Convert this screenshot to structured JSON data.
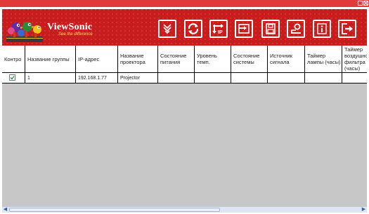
{
  "brand": {
    "name": "ViewSonic",
    "tagline": "See the difference"
  },
  "toolbar": {
    "buttons": [
      {
        "name": "filter-button",
        "icon": "chevron-down-icon"
      },
      {
        "name": "refresh-button",
        "icon": "refresh-icon"
      },
      {
        "name": "ip-button",
        "icon": "ip-swap-icon"
      },
      {
        "name": "import-button",
        "icon": "import-icon"
      },
      {
        "name": "save-button",
        "icon": "floppy-icon"
      },
      {
        "name": "settings-button",
        "icon": "key-icon"
      },
      {
        "name": "info-button",
        "icon": "info-icon"
      },
      {
        "name": "exit-button",
        "icon": "exit-icon"
      }
    ]
  },
  "table": {
    "headers": [
      "Контро",
      "Название группы",
      "IP-адрес",
      "Название проектора",
      "Состояние питания",
      "Уровень темп.",
      "Состояние системы",
      "Источник сигнала",
      "Таймер лампы (часы)",
      "Таймер воздушного фильтра (часы)"
    ],
    "rows": [
      {
        "checked": true,
        "group": "1",
        "ip": "192.168.1.77",
        "projector": "Projector",
        "power": "",
        "temp": "",
        "system": "",
        "source": "",
        "lamp": "",
        "filter": ""
      }
    ]
  },
  "colors": {
    "header_red": "#c91d1d",
    "grid_gray": "#c7c7c7",
    "scroll_blue": "#3a5ea8"
  }
}
